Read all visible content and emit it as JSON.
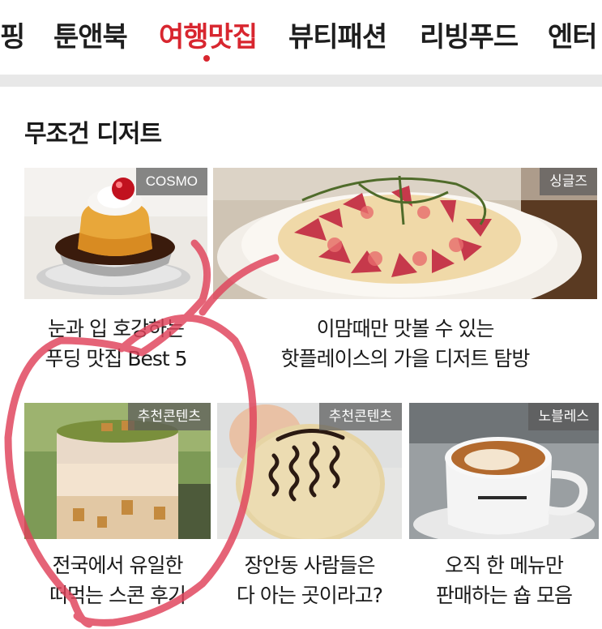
{
  "tabs": [
    {
      "label": "핑",
      "active": false
    },
    {
      "label": "툰앤북",
      "active": false
    },
    {
      "label": "여행맛집",
      "active": true
    },
    {
      "label": "뷰티패션",
      "active": false
    },
    {
      "label": "리빙푸드",
      "active": false
    },
    {
      "label": "엔터",
      "active": false
    }
  ],
  "colors": {
    "accent": "#d8262f",
    "heart_stroke": "#e0425a"
  },
  "section": {
    "title": "무조건 디저트"
  },
  "cards": [
    {
      "badge": "COSMO",
      "line1": "눈과 입 호강하는",
      "line2": "푸딩 맛집 Best 5",
      "image": "pudding-photo"
    },
    {
      "badge": "싱글즈",
      "line1": "이맘때만 맛볼 수 있는",
      "line2": "핫플레이스의 가을 디저트 탐방",
      "image": "fig-tart-photo"
    },
    {
      "badge": "추천콘텐츠",
      "line1": "전국에서 유일한",
      "line2": "떠먹는 스콘 후기",
      "image": "scone-cup-photo"
    },
    {
      "badge": "추천콘텐츠",
      "line1": "장안동 사람들은",
      "line2": "다 아는 곳이라고?",
      "image": "cookie-photo"
    },
    {
      "badge": "노블레스",
      "line1": "오직 한 메뉴만",
      "line2": "판매하는 숍 모음",
      "image": "coffee-cup-photo"
    }
  ]
}
